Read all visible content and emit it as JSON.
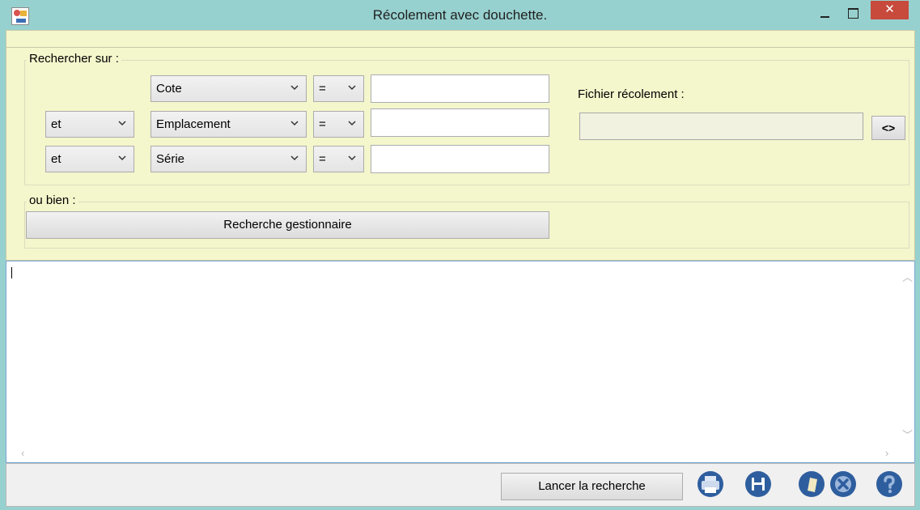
{
  "window": {
    "title": "Récolement avec douchette.",
    "close_glyph": "✕"
  },
  "search": {
    "legend": "Rechercher sur :",
    "rows": [
      {
        "connector": "",
        "field": "Cote",
        "operator": "=",
        "value": ""
      },
      {
        "connector": "et",
        "field": "Emplacement",
        "operator": "=",
        "value": ""
      },
      {
        "connector": "et",
        "field": "Série",
        "operator": "=",
        "value": ""
      }
    ]
  },
  "file": {
    "label": "Fichier récolement :",
    "value": "",
    "browse_label": "<>"
  },
  "alt": {
    "legend": "ou bien :",
    "manager_search_label": "Recherche gestionnaire"
  },
  "results": {
    "text": ""
  },
  "footer": {
    "launch_label": "Lancer la recherche",
    "icons": [
      "printer-icon",
      "save-icon",
      "eraser-icon",
      "cancel-icon",
      "help-icon"
    ]
  },
  "colors": {
    "titlebar": "#97d1cf",
    "panel": "#f4f6cc",
    "close": "#c74a3c",
    "icon_blue": "#2e5e9e"
  }
}
